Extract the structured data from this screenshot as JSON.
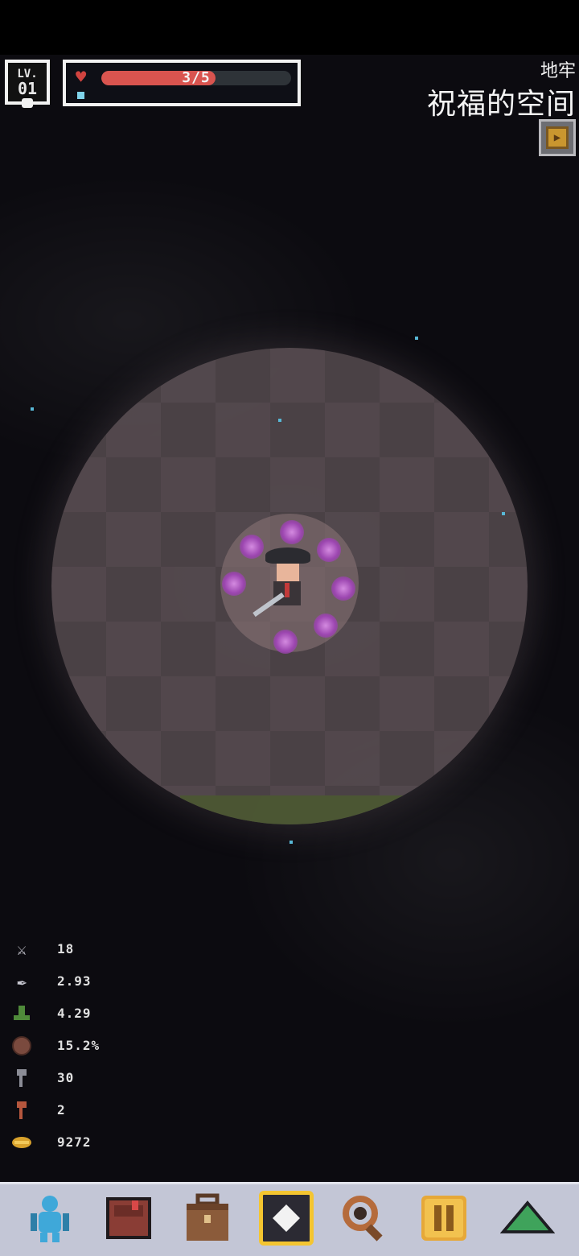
{
  "hud": {
    "level_label": "LV.",
    "level_value": "01",
    "hp_text": "3/5",
    "hp_fraction": 0.6,
    "area_label": "地牢",
    "area_title": "祝福的空间"
  },
  "icons": {
    "heart": "heart-icon",
    "map": "map-icon"
  },
  "stats": [
    {
      "icon": "crossed-swords-icon",
      "value": "18",
      "color": "#c9c9d2"
    },
    {
      "icon": "attack-speed-icon",
      "value": "2.93",
      "color": "#c9c9d2"
    },
    {
      "icon": "boot-icon",
      "value": "4.29",
      "color": "#4f8a3a"
    },
    {
      "icon": "shield-icon",
      "value": "15.2%",
      "color": "#7a4a3e"
    },
    {
      "icon": "gray-key-icon",
      "value": "30",
      "color": "#8b8c96"
    },
    {
      "icon": "red-key-icon",
      "value": "2",
      "color": "#b5563d"
    },
    {
      "icon": "gold-coin-icon",
      "value": "9272",
      "color": "#d9a22c"
    }
  ],
  "nav": [
    {
      "icon": "character-icon",
      "color": "#3fa8d9"
    },
    {
      "icon": "book-icon",
      "color": "#8a3d35"
    },
    {
      "icon": "backpack-icon",
      "color": "#8b5b3a"
    },
    {
      "icon": "center-view-icon",
      "color": "#f4c530"
    },
    {
      "icon": "magnifier-icon",
      "color": "#b56b3c"
    },
    {
      "icon": "pause-icon",
      "color": "#e6a838"
    },
    {
      "icon": "up-arrow-icon",
      "color": "#3fa35b"
    }
  ]
}
